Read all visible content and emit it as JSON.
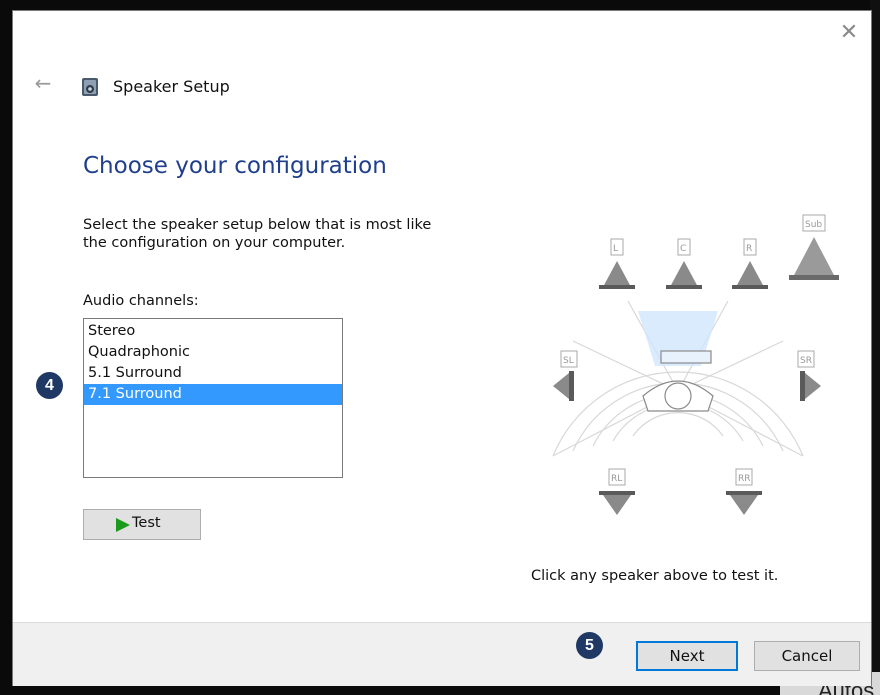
{
  "window": {
    "title": "Speaker Setup",
    "close_glyph": "✕",
    "back_glyph": "←"
  },
  "main": {
    "heading": "Choose your configuration",
    "instruction_line1": "Select the speaker setup below that is most like",
    "instruction_line2": "the configuration on your computer.",
    "channels_label": "Audio channels:",
    "channels": [
      "Stereo",
      "Quadraphonic",
      "5.1 Surround",
      "7.1 Surround"
    ],
    "selected_channel": "7.1 Surround",
    "test_label": "Test",
    "hint": "Click any speaker above to test it."
  },
  "speakers": {
    "labels": [
      "L",
      "C",
      "R",
      "Sub",
      "SL",
      "SR",
      "RL",
      "RR"
    ]
  },
  "footer": {
    "next_label": "Next",
    "cancel_label": "Cancel"
  },
  "badges": {
    "step_a": "4",
    "step_b": "5",
    "color": "#1f3864"
  },
  "background": {
    "corner_text": "Autos"
  },
  "colors": {
    "heading": "#1f3f8c",
    "selection": "#3399ff",
    "accent_border": "#0078d7"
  },
  "icons": {
    "play": "play-icon",
    "app": "speaker-setup-icon"
  }
}
